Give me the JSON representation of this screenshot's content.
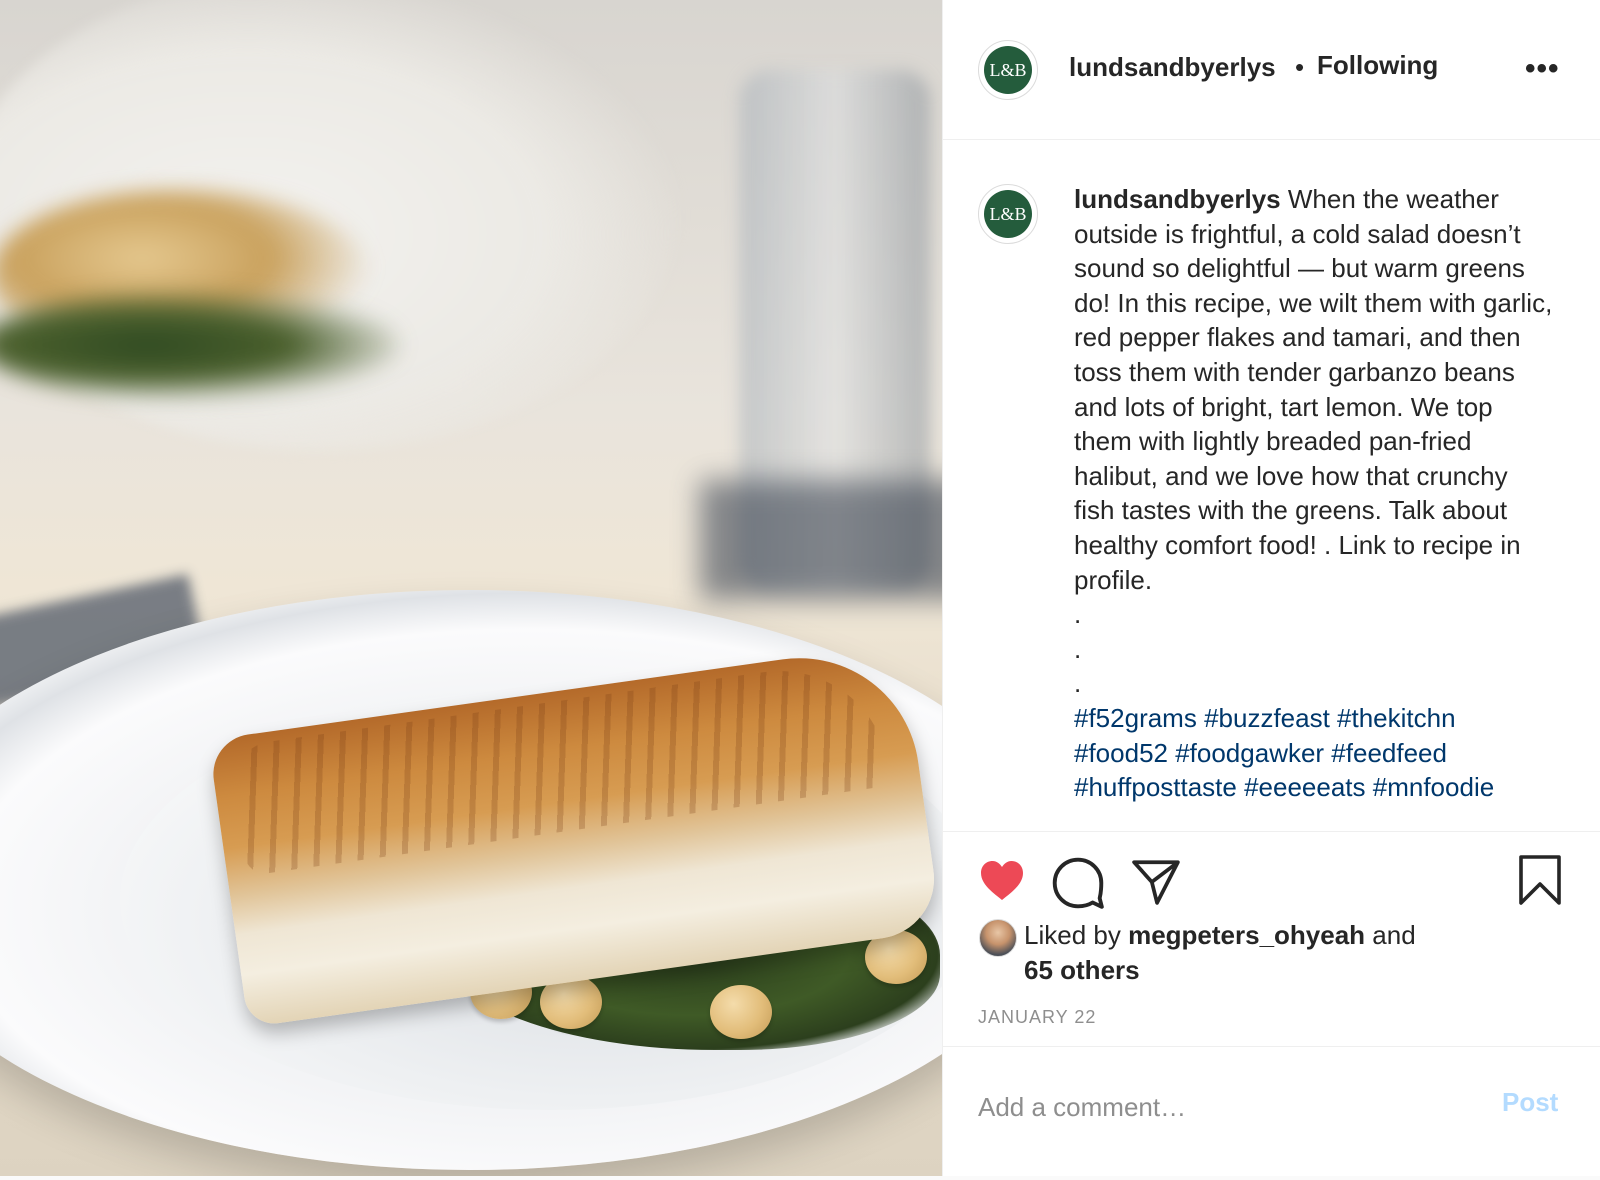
{
  "post": {
    "username": "lundsandbyerlys",
    "separator": "•",
    "follow_status": "Following",
    "more_label": "•••",
    "avatar_text": "L&B",
    "caption_lines": [
      "When the weather outside is frightful, a cold salad doesn’t sound so delightful — but warm greens do! In this recipe, we wilt them with garlic, red pepper flakes and tamari, and then toss them with tender garbanzo beans and lots of bright, tart lemon. We top them with lightly breaded pan-fried halibut, and we love how that crunchy fish tastes with the greens. Talk about healthy comfort food! . Link to recipe in profile."
    ],
    "dots": [
      ".",
      ".",
      "."
    ],
    "hashtags": "#f52grams #buzzfeast #thekitchn #food52 #foodgawker #feedfeed #huffposttaste #eeeeeats #mnfoodie",
    "liked": true,
    "likes_prefix": "Liked by",
    "likes_user": "megpeters_ohyeah",
    "likes_and": "and",
    "likes_others": "65 others",
    "date": "JANUARY 22",
    "comment_placeholder": "Add a comment…",
    "post_button": "Post"
  },
  "icons": {
    "like": "heart-icon",
    "comment": "comment-icon",
    "share": "paper-plane-icon",
    "save": "bookmark-icon",
    "more": "more-options-icon"
  },
  "colors": {
    "heart": "#ed4956",
    "brand_avatar": "#245c3c",
    "hashtag": "#00376b",
    "post_button_disabled": "#b3dbff"
  }
}
